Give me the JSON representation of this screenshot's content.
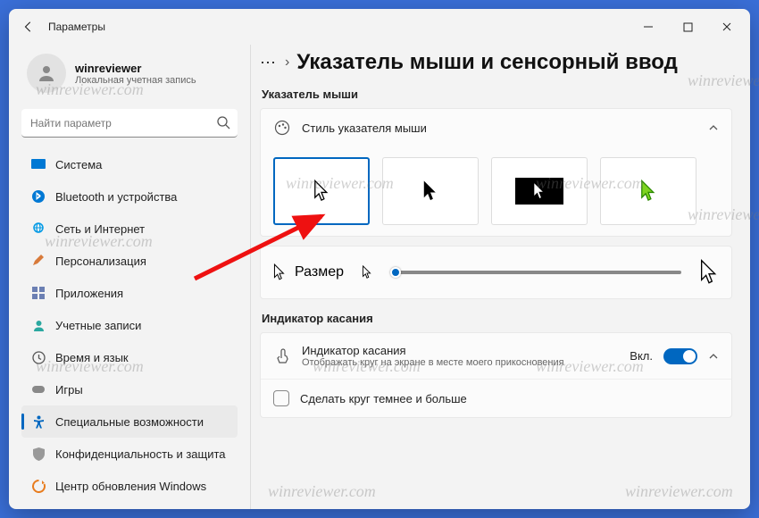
{
  "watermark": "winreviewer.com",
  "titlebar": {
    "app": "Параметры"
  },
  "user": {
    "name": "winreviewer",
    "sub": "Локальная учетная запись"
  },
  "search": {
    "placeholder": "Найти параметр"
  },
  "nav": {
    "items": [
      {
        "label": "Система"
      },
      {
        "label": "Bluetooth и устройства"
      },
      {
        "label": "Сеть и Интернет"
      },
      {
        "label": "Персонализация"
      },
      {
        "label": "Приложения"
      },
      {
        "label": "Учетные записи"
      },
      {
        "label": "Время и язык"
      },
      {
        "label": "Игры"
      },
      {
        "label": "Специальные возможности"
      },
      {
        "label": "Конфиденциальность и защита"
      },
      {
        "label": "Центр обновления Windows"
      }
    ]
  },
  "page": {
    "title": "Указатель мыши и сенсорный ввод",
    "section1": "Указатель мыши",
    "style_label": "Стиль указателя мыши",
    "size_label": "Размер",
    "section2": "Индикатор касания",
    "touch": {
      "title": "Индикатор касания",
      "sub": "Отображать круг на экране в месте моего прикосновения",
      "state": "Вкл."
    },
    "touch_opt": "Сделать круг темнее и больше"
  }
}
